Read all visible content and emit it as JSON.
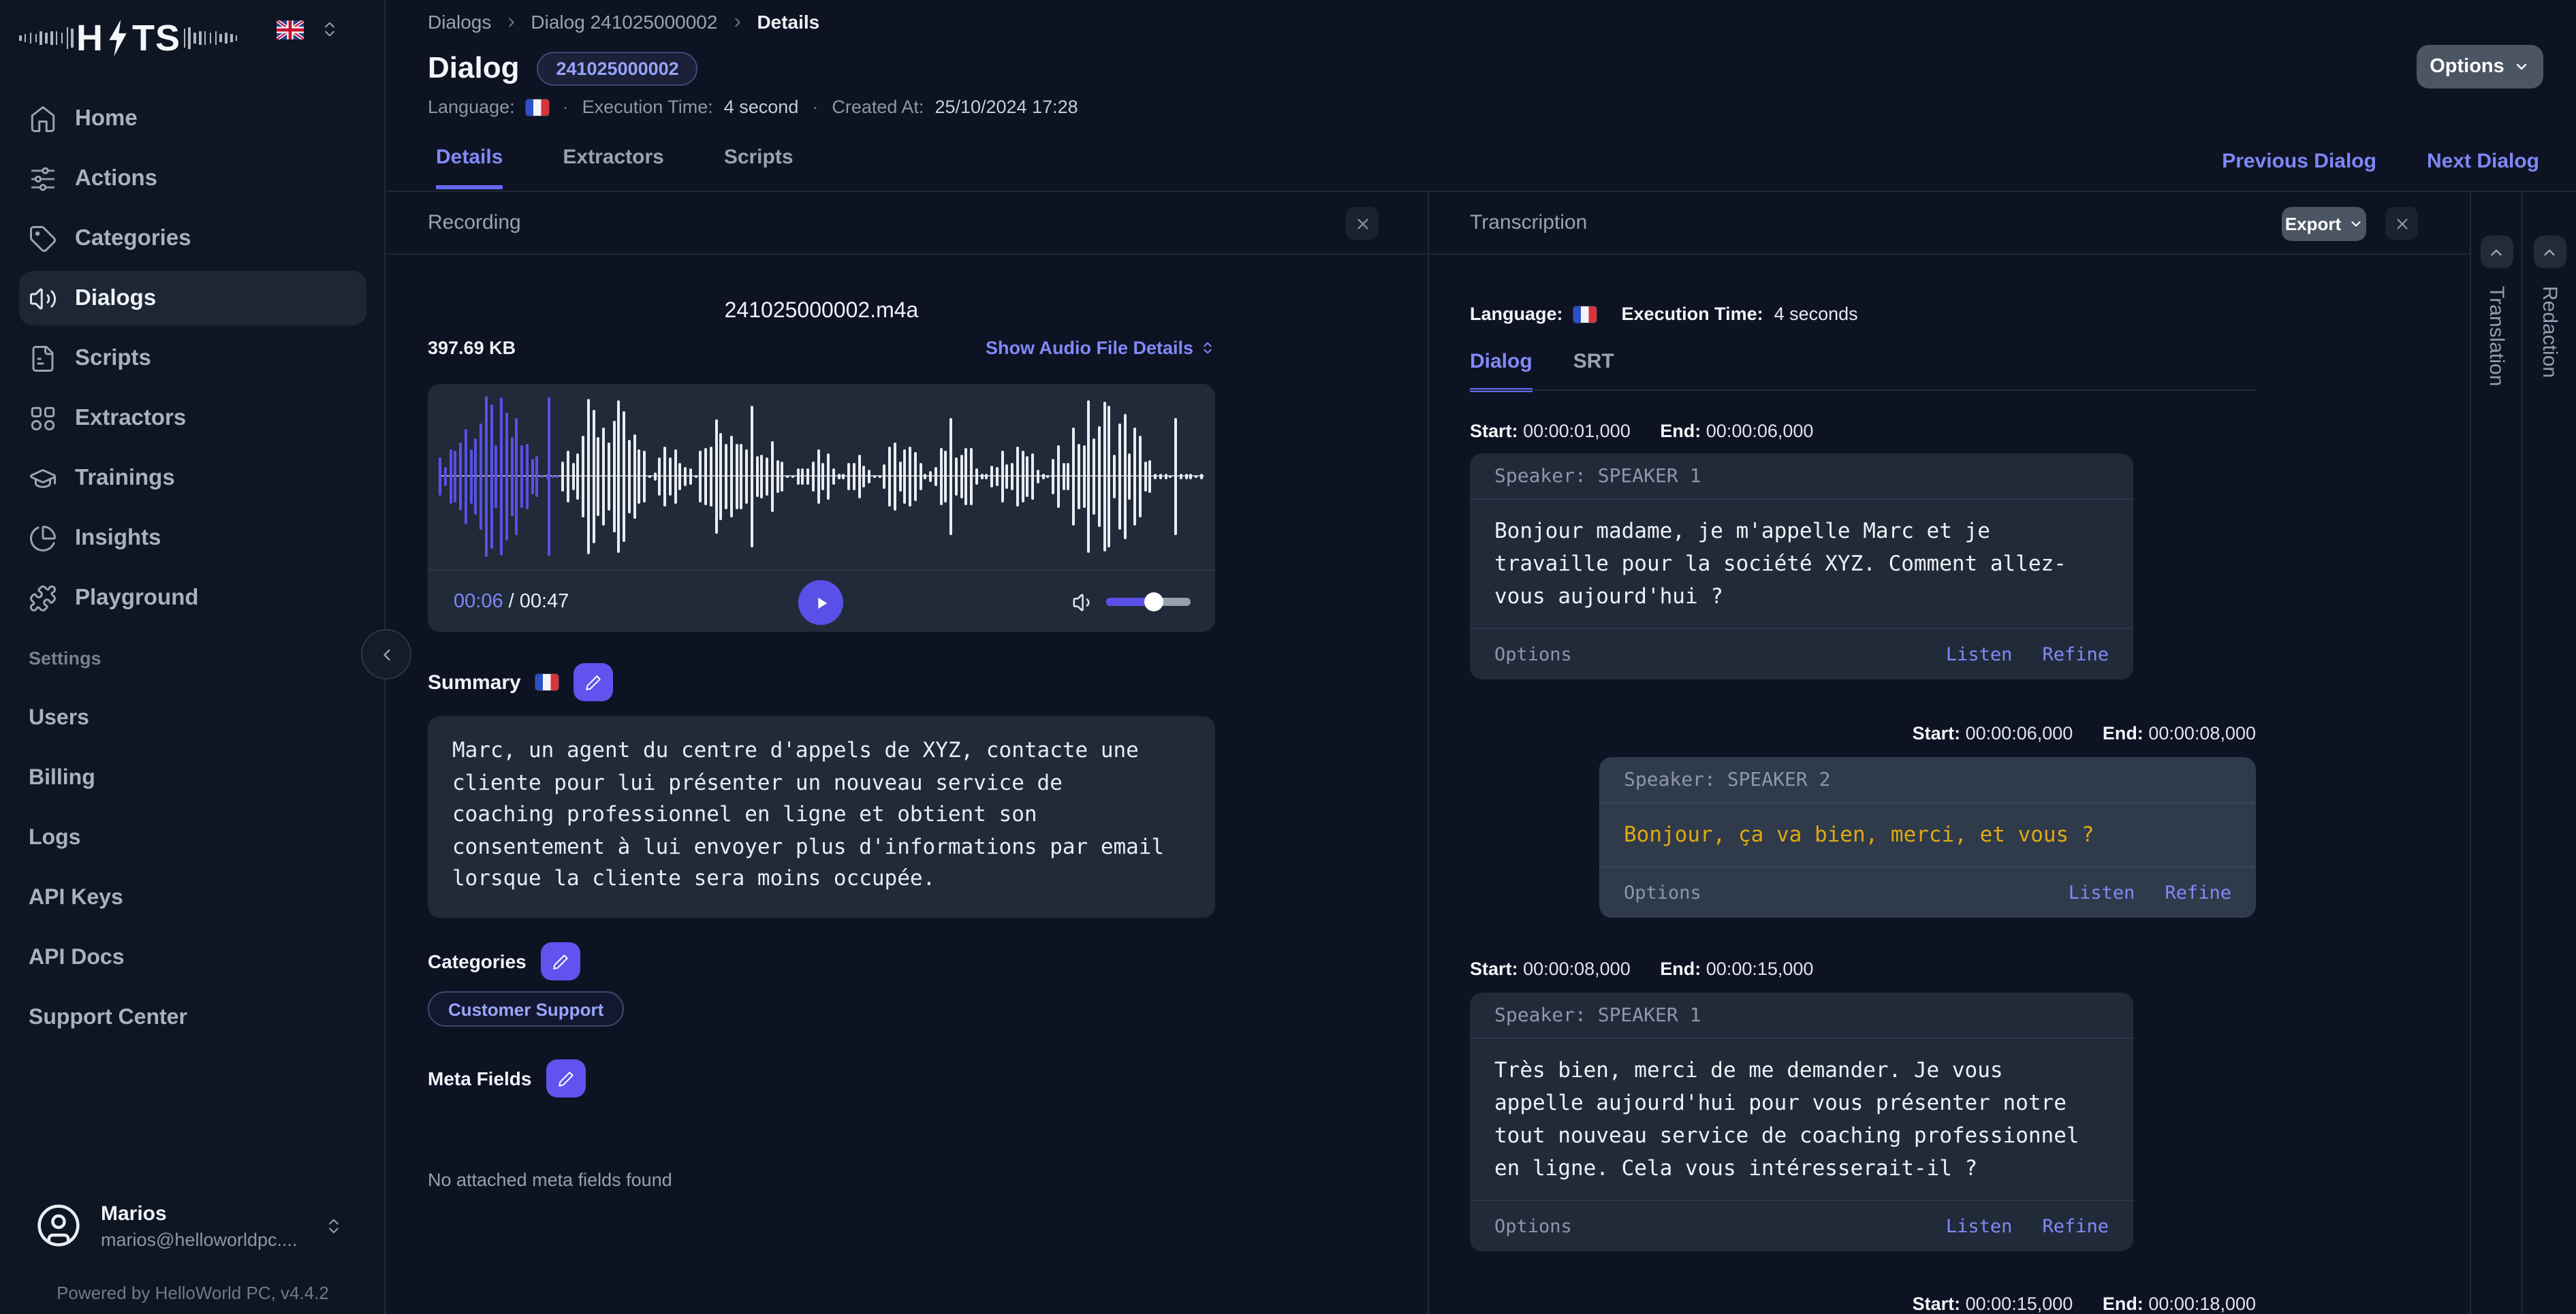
{
  "sidebar": {
    "logo_text_1": "H",
    "logo_text_2": "TS",
    "nav": [
      {
        "label": "Home"
      },
      {
        "label": "Actions"
      },
      {
        "label": "Categories"
      },
      {
        "label": "Dialogs"
      },
      {
        "label": "Scripts"
      },
      {
        "label": "Extractors"
      },
      {
        "label": "Trainings"
      },
      {
        "label": "Insights"
      },
      {
        "label": "Playground"
      }
    ],
    "section_label": "Settings",
    "section_items": [
      {
        "label": "Users"
      },
      {
        "label": "Billing"
      },
      {
        "label": "Logs"
      },
      {
        "label": "API Keys"
      },
      {
        "label": "API Docs"
      },
      {
        "label": "Support Center"
      }
    ],
    "user": {
      "name": "Marios",
      "email": "marios@helloworldpc...."
    },
    "powered_by": "Powered by HelloWorld PC, v4.4.2"
  },
  "header": {
    "breadcrumb": [
      {
        "label": "Dialogs"
      },
      {
        "label": "Dialog 241025000002"
      },
      {
        "label": "Details"
      }
    ],
    "title": "Dialog",
    "badge": "241025000002",
    "language_label": "Language:",
    "exec_time_label": "Execution Time:",
    "exec_time_value": "4 second",
    "created_label": "Created At:",
    "created_value": "25/10/2024 17:28",
    "options_label": "Options",
    "tabs": [
      {
        "label": "Details"
      },
      {
        "label": "Extractors"
      },
      {
        "label": "Scripts"
      }
    ],
    "previous_label": "Previous Dialog",
    "next_label": "Next Dialog"
  },
  "recording": {
    "title": "Recording",
    "filename": "241025000002.m4a",
    "filesize": "397.69 KB",
    "details_link": "Show Audio File Details",
    "time_current": "00:06",
    "time_separator": "/",
    "time_total": "00:47",
    "summary_label": "Summary",
    "summary_lines": [
      "Marc, un agent du centre d'appels de XYZ, contacte une",
      "cliente pour lui présenter un nouveau service de",
      "coaching professionnel en ligne et obtient son",
      "consentement à lui envoyer plus d'informations par email",
      "lorsque la cliente sera moins occupée."
    ],
    "categories_label": "Categories",
    "category_badge": "Customer Support",
    "meta_fields_label": "Meta Fields",
    "meta_fields_empty": "No attached meta fields found"
  },
  "transcription": {
    "title": "Transcription",
    "export_label": "Export",
    "language_label": "Language:",
    "exec_time_label": "Execution Time:",
    "exec_time_value": "4 seconds",
    "tabs": [
      {
        "label": "Dialog"
      },
      {
        "label": "SRT"
      }
    ],
    "entries": [
      {
        "start_label": "Start:",
        "start_value": "00:00:01,000",
        "end_label": "End:",
        "end_value": "00:00:06,000",
        "speaker": "Speaker: SPEAKER 1",
        "text_lines": [
          "Bonjour madame, je m'appelle Marc et je",
          "travaille pour la société XYZ. Comment allez-",
          "vous aujourd'hui ?"
        ],
        "options_label": "Options",
        "listen_label": "Listen",
        "refine_label": "Refine"
      },
      {
        "start_label": "Start:",
        "start_value": "00:00:06,000",
        "end_label": "End:",
        "end_value": "00:00:08,000",
        "speaker": "Speaker: SPEAKER 2",
        "text_lines": [
          "Bonjour, ça va bien, merci, et vous ?"
        ],
        "options_label": "Options",
        "listen_label": "Listen",
        "refine_label": "Refine"
      },
      {
        "start_label": "Start:",
        "start_value": "00:00:08,000",
        "end_label": "End:",
        "end_value": "00:00:15,000",
        "speaker": "Speaker: SPEAKER 1",
        "text_lines": [
          "Très bien, merci de me demander. Je vous",
          "appelle aujourd'hui pour vous présenter notre",
          "tout nouveau service de coaching professionnel",
          "en ligne. Cela vous intéresserait-il ?"
        ],
        "options_label": "Options",
        "listen_label": "Listen",
        "refine_label": "Refine"
      },
      {
        "start_label": "Start:",
        "start_value": "00:00:15,000",
        "end_label": "End:",
        "end_value": "00:00:18,000"
      }
    ]
  },
  "side_panels": [
    {
      "label": "Translation"
    },
    {
      "label": "Redaction"
    }
  ],
  "colors": {
    "page_bg": "#0d1322",
    "card_bg": "#212a39",
    "speaker2_card_bg": "#2f3a4b",
    "accent_purple": "#5a50e8",
    "link_purple": "#828af8",
    "speaker2_text": "#dfa90f",
    "button_gray": "#4b5564"
  }
}
